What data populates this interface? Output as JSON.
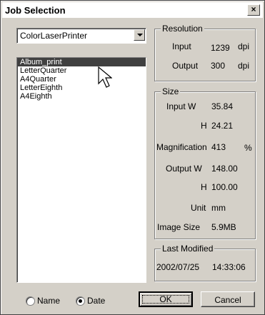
{
  "window": {
    "title": "Job Selection",
    "close_glyph": "×"
  },
  "printer": {
    "selected": "ColorLaserPrinter"
  },
  "jobs": {
    "items": [
      "Album_print",
      "LetterQuarter",
      "A4Quarter",
      "LetterEighth",
      "A4Eighth"
    ],
    "selected_index": 0
  },
  "resolution": {
    "legend": "Resolution",
    "input_label": "Input",
    "input_value": "1239",
    "input_unit": "dpi",
    "output_label": "Output",
    "output_value": "300",
    "output_unit": "dpi"
  },
  "size": {
    "legend": "Size",
    "input_w_label": "Input W",
    "input_w_value": "35.84",
    "input_h_label": "H",
    "input_h_value": "24.21",
    "magnification_label": "Magnification",
    "magnification_value": "413",
    "magnification_unit": "%",
    "output_w_label": "Output W",
    "output_w_value": "148.00",
    "output_h_label": "H",
    "output_h_value": "100.00",
    "unit_label": "Unit",
    "unit_value": "mm",
    "image_size_label": "Image Size",
    "image_size_value": "5.9MB"
  },
  "last_modified": {
    "legend": "Last Modified",
    "date": "2002/07/25",
    "time": "14:33:06"
  },
  "sort": {
    "name_label": "Name",
    "date_label": "Date",
    "selected": "date"
  },
  "buttons": {
    "ok": "OK",
    "cancel": "Cancel"
  },
  "icons": {
    "cursor": "arrow-cursor-icon",
    "dropdown": "dropdown-arrow-icon",
    "close": "close-icon"
  }
}
